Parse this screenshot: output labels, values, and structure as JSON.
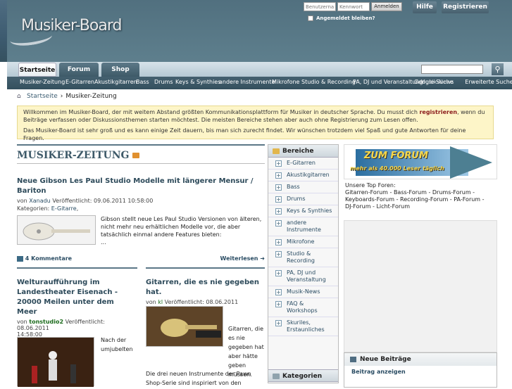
{
  "header": {
    "logo": "Musiker-Board",
    "username_placeholder": "Benutzername",
    "password_placeholder": "Kennwort",
    "login_button": "Anmelden",
    "remember_me": "Angemeldet bleiben?",
    "help_button": "Hilfe",
    "register_button": "Registrieren"
  },
  "nav": {
    "tabs": [
      "Startseite",
      "Forum",
      "Shop"
    ],
    "subnav": [
      "Musiker-Zeitung",
      "E-Gitarren",
      "Akustikgitarren",
      "Bass",
      "Drums",
      "Keys & Synthies",
      "andere Instrumente",
      "Mikrofone",
      "Studio & Recording",
      "PA, DJ und Veranstaltung",
      "Musik-News"
    ],
    "google_search": "Google-Suche",
    "advanced_search": "Erweiterte Suche"
  },
  "breadcrumb": {
    "home": "Startseite",
    "current": "Musiker-Zeitung"
  },
  "welcome": {
    "line1a": "Willkommen im Musiker-Board, der mit weitem Abstand größten Kommunikationsplattform für Musiker in deutscher Sprache. Du musst dich ",
    "register_link": "registrieren",
    "line1b": ", wenn du Beiträge verfassen oder Diskussionsthemen starten möchtest. Die meisten Bereiche stehen aber auch ohne Registrierung zum Lesen offen.",
    "line2": "Das Musiker-Board ist sehr groß und es kann einige Zeit dauern, bis man sich zurecht findet. Wir wünschen trotzdem viel Spaß und gute Antworten für deine Fragen."
  },
  "main": {
    "title": "MUSIKER-ZEITUNG",
    "article1": {
      "title": "Neue Gibson Les Paul Studio Modelle mit längerer Mensur / Bariton",
      "by": "von",
      "author": "Xanadu",
      "published": "Veröffentlicht: 09.06.2011 10:58:00",
      "categories_label": "Kategorien:",
      "category": "E-Gitarre",
      "teaser": "Gibson stellt neue Les Paul Studio Versionen von älteren, nicht mehr neu erhältlichen Modelle vor, die aber tatsächlich einmal andere Features bieten:",
      "ellipsis": "...",
      "comments": "4 Kommentare",
      "read_more": "Weiterlesen"
    },
    "article2": {
      "title": "Welturaufführung im Landestheater Eisenach - 20000 Meilen unter dem Meer",
      "by": "von",
      "author": "tonstudio2",
      "published": "Veröffentlicht: 08.06.2011",
      "time": "14:58:00",
      "teaser": "Nach der umjubelten"
    },
    "article3": {
      "title": "Gitarren, die es nie gegeben hat.",
      "by": "von",
      "author": "kl",
      "published": "Veröffentlicht: 08.06.2011 10:38:00",
      "teaser": "Gitarren, die es nie gegeben hat aber hätte geben müssen.",
      "teaser2": "Die drei neuen Instrumente der Pawn Shop-Serie sind inspiriert von den"
    }
  },
  "bereiche": {
    "title": "Bereiche",
    "items": [
      "E-Gitarren",
      "Akustikgitarren",
      "Bass",
      "Drums",
      "Keys & Synthies",
      "andere Instrumente",
      "Mikrofone",
      "Studio & Recording",
      "PA, DJ und Veranstaltung",
      "Musik-News",
      "FAQ & Workshops",
      "Skuriles, Erstaunliches"
    ],
    "categories_title": "Kategorien"
  },
  "right": {
    "banner_line1": "ZUM FORUM",
    "banner_line2": "mehr als 40.000 Leser täglich",
    "top_forums_label": "Unsere Top Foren:",
    "top_forums": "Gitarren-Forum - Bass-Forum - Drums-Forum - Keyboards-Forum - Recording-Forum - PA-Forum - DJ-Forum - Licht-Forum",
    "new_posts_title": "Neue Beiträge",
    "new_posts_link": "Beitrag anzeigen"
  },
  "colors": {
    "accent": "#3e5a69",
    "welcome_bg": "#fdf5c8",
    "link": "#2b4d64"
  }
}
